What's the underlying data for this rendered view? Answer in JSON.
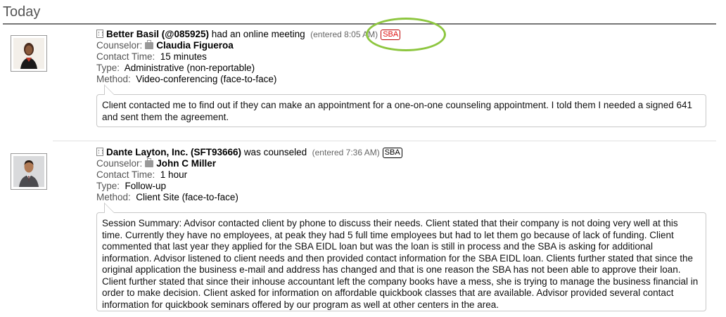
{
  "day_header": "Today",
  "entries": [
    {
      "client": "Better Basil (@085925)",
      "action": "had an online meeting",
      "entered": "(entered 8:05 AM)",
      "badge": "SBA",
      "counselor_label": "Counselor:",
      "counselor": "Claudia Figueroa",
      "contact_time_label": "Contact Time:",
      "contact_time": "15 minutes",
      "type_label": "Type:",
      "type": "Administrative (non-reportable)",
      "method_label": "Method:",
      "method": "Video-conferencing (face-to-face)",
      "note": "Client contacted me to find out if they can make an appointment for a one-on-one counseling appointment. I told them I needed a signed 641 and sent them the agreement."
    },
    {
      "client": "Dante Layton, Inc. (SFT93666)",
      "action": "was counseled",
      "entered": "(entered 7:36 AM)",
      "badge": "SBA",
      "counselor_label": "Counselor:",
      "counselor": "John C Miller",
      "contact_time_label": "Contact Time:",
      "contact_time": "1 hour",
      "type_label": "Type:",
      "type": "Follow-up",
      "method_label": "Method:",
      "method": "Client Site (face-to-face)",
      "note": "Session Summary: Advisor contacted client by phone to discuss their needs. Client stated that their company is not doing very well at this time. Currently they have no employees, at peak they had 5 full time employees but had to let them go because of lack of funding. Client commented that last year they applied for the SBA EIDL loan but was the loan is still in process and the SBA is asking for additional information. Advisor listened to client needs and then provided contact information for the SBA EIDL loan. Clients further stated that since the original application the business e-mail and address has changed and that is one reason the SBA has not been able to approve their loan. Client further stated that since their inhouse accountant left the company books have a mess, she is trying to manage the business financial in order to make decision. Client asked for information on affordable quickbook classes that are available. Advisor provided several contact information for quickbook seminars offered by our program as well at other centers in the area."
    }
  ],
  "colors": {
    "highlight": "#8dc63f",
    "badge_red": "#e01010"
  }
}
